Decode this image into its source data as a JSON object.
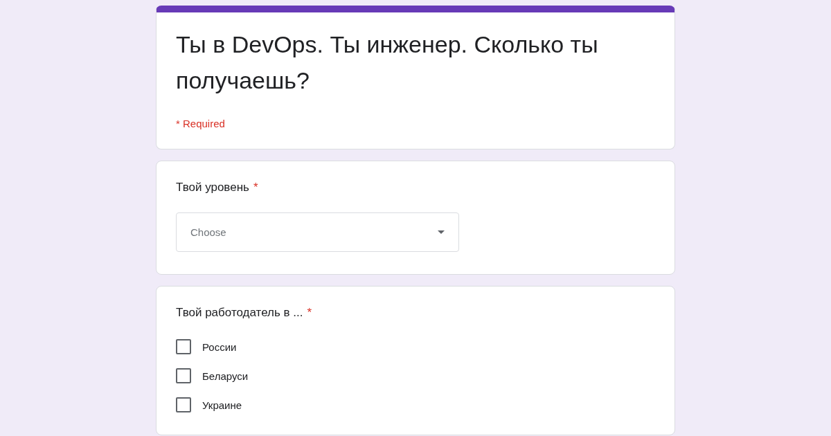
{
  "form": {
    "title": "Ты в DevOps. Ты инженер. Сколько ты получаешь?",
    "required_note": "* Required"
  },
  "questions": [
    {
      "kind": "dropdown",
      "label": "Твой уровень",
      "required_mark": "*",
      "placeholder": "Choose"
    },
    {
      "kind": "checkboxes",
      "label": "Твой работодатель в ...",
      "required_mark": "*",
      "options": [
        {
          "label": "России",
          "checked": false
        },
        {
          "label": "Беларуси",
          "checked": false
        },
        {
          "label": "Украине",
          "checked": false
        }
      ]
    }
  ]
}
